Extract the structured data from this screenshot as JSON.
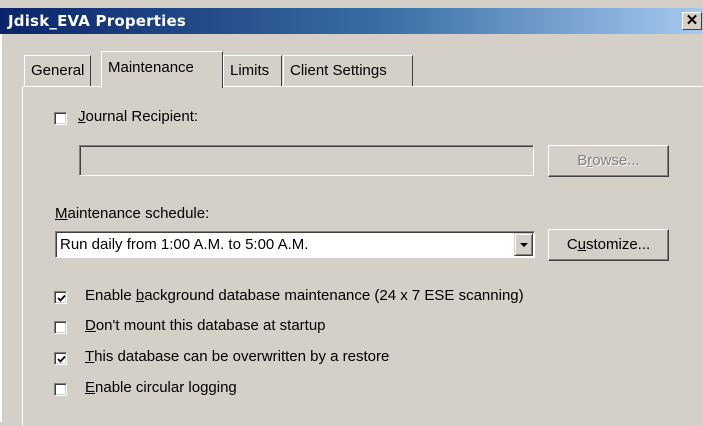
{
  "window": {
    "title": "Jdisk_EVA Properties",
    "close_glyph": "✕"
  },
  "tabs": [
    {
      "label": "General",
      "active": false
    },
    {
      "label": "Maintenance",
      "active": true
    },
    {
      "label": "Limits",
      "active": false
    },
    {
      "label": "Client Settings",
      "active": false
    }
  ],
  "journal": {
    "checkbox_label_mnemonic": "J",
    "checkbox_label_rest": "ournal Recipient:",
    "checked": false,
    "recipient_value": "",
    "browse_pre": "B",
    "browse_mnemonic": "r",
    "browse_rest": "owse..."
  },
  "schedule": {
    "label_mnemonic": "M",
    "label_rest": "aintenance schedule:",
    "selected": "Run daily from 1:00 A.M. to 5:00 A.M.",
    "customize_pre": "C",
    "customize_mnemonic": "u",
    "customize_rest": "stomize..."
  },
  "options": [
    {
      "pre": "Enable ",
      "mnemonic": "b",
      "rest": "ackground database maintenance (24 x 7 ESE scanning)",
      "checked": true
    },
    {
      "pre": "",
      "mnemonic": "D",
      "rest": "on't mount this database at startup",
      "checked": false
    },
    {
      "pre": "",
      "mnemonic": "T",
      "rest": "his database can be overwritten by a restore",
      "checked": true
    },
    {
      "pre": "",
      "mnemonic": "E",
      "rest": "nable circular logging",
      "checked": false
    }
  ],
  "colors": {
    "titlebar_start": "#0a246a",
    "titlebar_end": "#a6caf0",
    "dialog_face": "#d4d0c8",
    "disabled_text": "#808080"
  }
}
